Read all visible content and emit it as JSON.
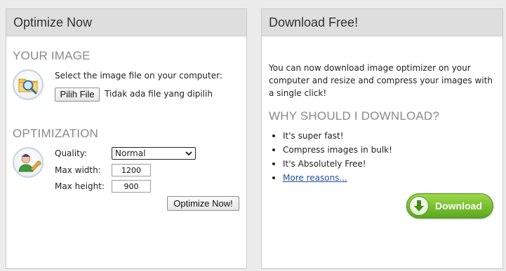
{
  "optimize": {
    "title": "Optimize Now",
    "your_image_heading": "YOUR IMAGE",
    "select_prompt": "Select the image file on your computer:",
    "choose_file_label": "Pilih File",
    "no_file_text": "Tidak ada file yang dipilih",
    "optimization_heading": "OPTIMIZATION",
    "quality_label": "Quality:",
    "quality_value": "Normal",
    "max_width_label": "Max width:",
    "max_width_value": "1200",
    "max_height_label": "Max height:",
    "max_height_value": "900",
    "submit_label": "Optimize Now!"
  },
  "download": {
    "title": "Download Free!",
    "description": "You can now download image optimizer on your computer and resize and compress your images with a single click!",
    "why_heading": "WHY SHOULD I DOWNLOAD?",
    "reasons": [
      "It's super fast!",
      "Compress images in bulk!",
      "It's Absolutely Free!"
    ],
    "more_link": "More reasons...",
    "button_label": "Download"
  },
  "icons": {
    "image_icon": "folder-magnifier-icon",
    "settings_icon": "user-wrench-icon",
    "download_icon": "download-arrow-icon",
    "select_chevron": "chevron-down-icon"
  },
  "colors": {
    "heading_gray": "#8a8a8a",
    "link_blue": "#1f4e9c",
    "download_green": "#6ab82a"
  }
}
